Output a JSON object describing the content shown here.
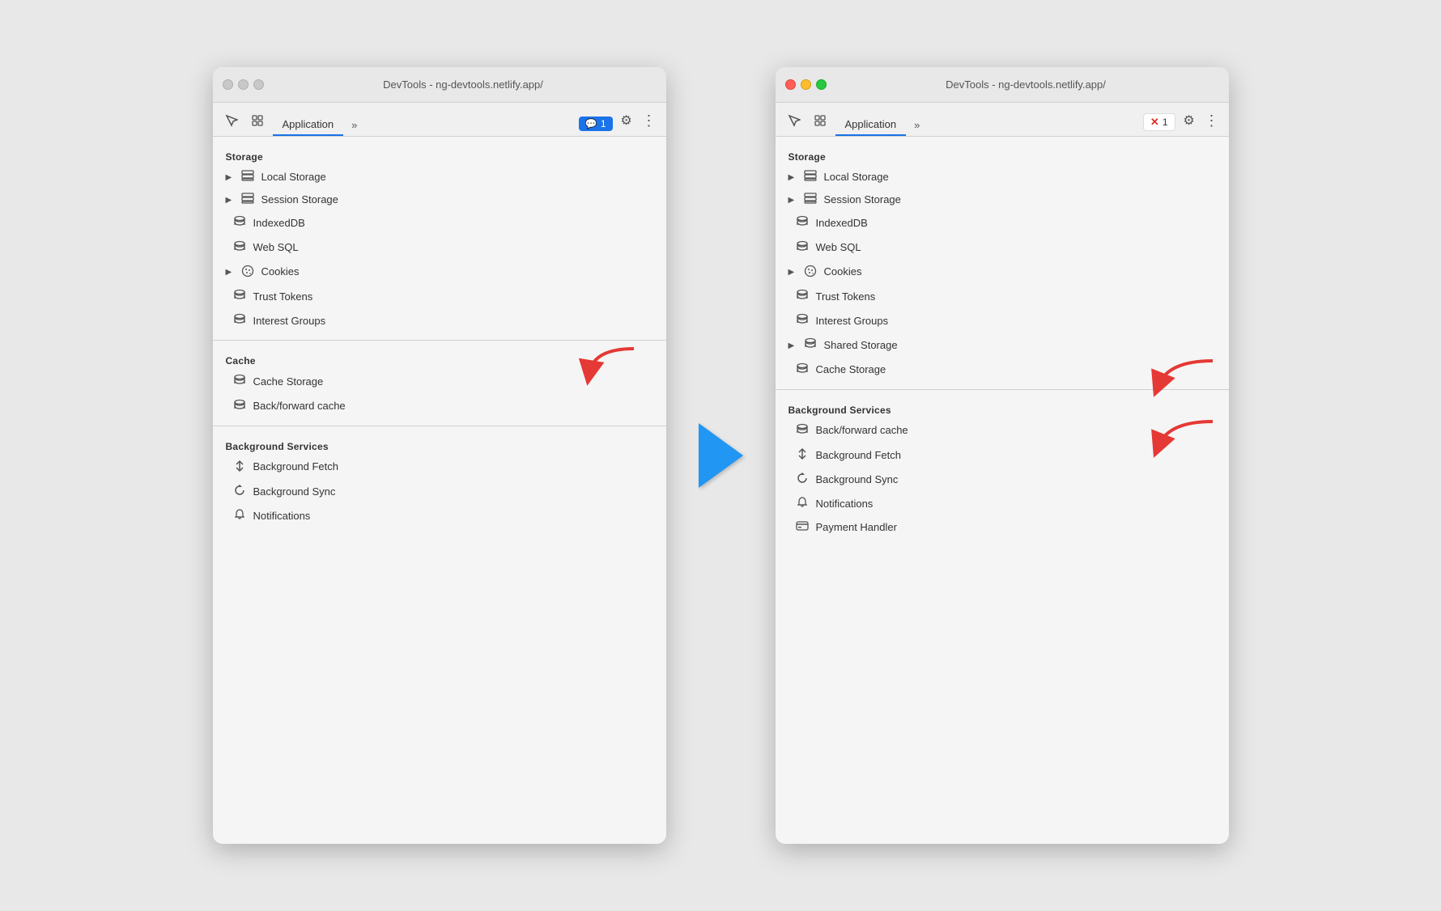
{
  "left_window": {
    "title": "DevTools - ng-devtools.netlify.app/",
    "tab_label": "Application",
    "traffic_lights": [
      "gray",
      "gray",
      "gray"
    ],
    "badge": {
      "icon": "💬",
      "count": "1",
      "style": "blue"
    },
    "storage_section": "Storage",
    "items_storage": [
      {
        "label": "Local Storage",
        "icon": "⊞",
        "has_arrow": true
      },
      {
        "label": "Session Storage",
        "icon": "⊞",
        "has_arrow": true
      },
      {
        "label": "IndexedDB",
        "icon": "🗄"
      },
      {
        "label": "Web SQL",
        "icon": "🗄"
      },
      {
        "label": "Cookies",
        "icon": "🍪",
        "has_arrow": true
      },
      {
        "label": "Trust Tokens",
        "icon": "🗄"
      },
      {
        "label": "Interest Groups",
        "icon": "🗄"
      }
    ],
    "cache_section": "Cache",
    "items_cache": [
      {
        "label": "Cache Storage",
        "icon": "🗄"
      },
      {
        "label": "Back/forward cache",
        "icon": "🗄"
      }
    ],
    "background_section": "Background Services",
    "items_background": [
      {
        "label": "Background Fetch",
        "icon": "↕"
      },
      {
        "label": "Background Sync",
        "icon": "↻"
      },
      {
        "label": "Notifications",
        "icon": "🔔"
      }
    ]
  },
  "right_window": {
    "title": "DevTools - ng-devtools.netlify.app/",
    "tab_label": "Application",
    "traffic_lights": [
      "red",
      "yellow",
      "green"
    ],
    "badge": {
      "icon": "✕",
      "count": "1",
      "style": "red"
    },
    "storage_section": "Storage",
    "items_storage": [
      {
        "label": "Local Storage",
        "icon": "⊞",
        "has_arrow": true
      },
      {
        "label": "Session Storage",
        "icon": "⊞",
        "has_arrow": true
      },
      {
        "label": "IndexedDB",
        "icon": "🗄"
      },
      {
        "label": "Web SQL",
        "icon": "🗄"
      },
      {
        "label": "Cookies",
        "icon": "🍪",
        "has_arrow": true
      },
      {
        "label": "Trust Tokens",
        "icon": "🗄"
      },
      {
        "label": "Interest Groups",
        "icon": "🗄"
      },
      {
        "label": "Shared Storage",
        "icon": "🗄",
        "has_arrow": true
      },
      {
        "label": "Cache Storage",
        "icon": "🗄"
      }
    ],
    "background_section": "Background Services",
    "items_background": [
      {
        "label": "Back/forward cache",
        "icon": "🗄"
      },
      {
        "label": "Background Fetch",
        "icon": "↕"
      },
      {
        "label": "Background Sync",
        "icon": "↻"
      },
      {
        "label": "Notifications",
        "icon": "🔔"
      },
      {
        "label": "Payment Handler",
        "icon": "💳"
      }
    ]
  },
  "icons": {
    "inspect": "⬚",
    "layers": "⧉",
    "chevron_right": "»",
    "gear": "⚙",
    "more": "⋮",
    "db": "🗄",
    "grid": "⊞",
    "cookie": "⊛",
    "arrow_updown": "⇅",
    "sync": "↺",
    "bell": "🔔",
    "card": "▬"
  }
}
